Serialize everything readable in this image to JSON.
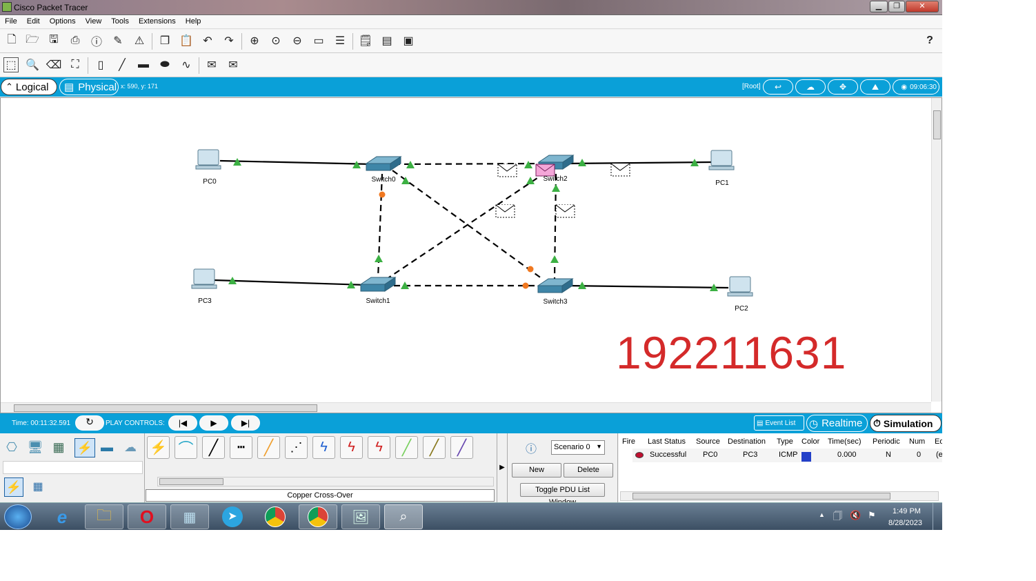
{
  "window": {
    "title": "Cisco Packet Tracer",
    "min": "▁",
    "max": "❐",
    "close": "✕"
  },
  "menu": [
    "File",
    "Edit",
    "Options",
    "View",
    "Tools",
    "Extensions",
    "Help"
  ],
  "help_label": "?",
  "viewbar": {
    "logical": "Logical",
    "physical": "Physical",
    "coords": "x: 590, y: 171",
    "root": "[Root]",
    "time": "09:06:30"
  },
  "devices": {
    "pc0": "PC0",
    "pc1": "PC1",
    "pc2": "PC2",
    "pc3": "PC3",
    "sw0": "Switch0",
    "sw1": "Switch1",
    "sw2": "Switch2",
    "sw3": "Switch3"
  },
  "watermark": "192211631",
  "sim": {
    "time": "Time: 00:11:32.591",
    "play": "PLAY CONTROLS:",
    "eventlist": "Event List",
    "realtime": "Realtime",
    "simulation": "Simulation"
  },
  "bottom": {
    "cable_label": "Copper Cross-Over",
    "scenario": "Scenario 0",
    "new": "New",
    "delete": "Delete",
    "toggle": "Toggle PDU List Window"
  },
  "pdu": {
    "headers": [
      "Fire",
      "Last Status",
      "Source",
      "Destination",
      "Type",
      "Color",
      "Time(sec)",
      "Periodic",
      "Num",
      "Ed"
    ],
    "rows": [
      {
        "status": "Successful",
        "source": "PC0",
        "dest": "PC3",
        "type": "ICMP",
        "color": "#2340c8",
        "time": "0.000",
        "periodic": "N",
        "num": "0",
        "ed": "(e"
      }
    ]
  },
  "taskbar": {
    "time": "1:49 PM",
    "date": "8/28/2023"
  },
  "colors": {
    "accent": "#0aa0d8",
    "link_up": "#3cb043",
    "link_wait": "#f07820",
    "watermark": "#d42a2a"
  }
}
